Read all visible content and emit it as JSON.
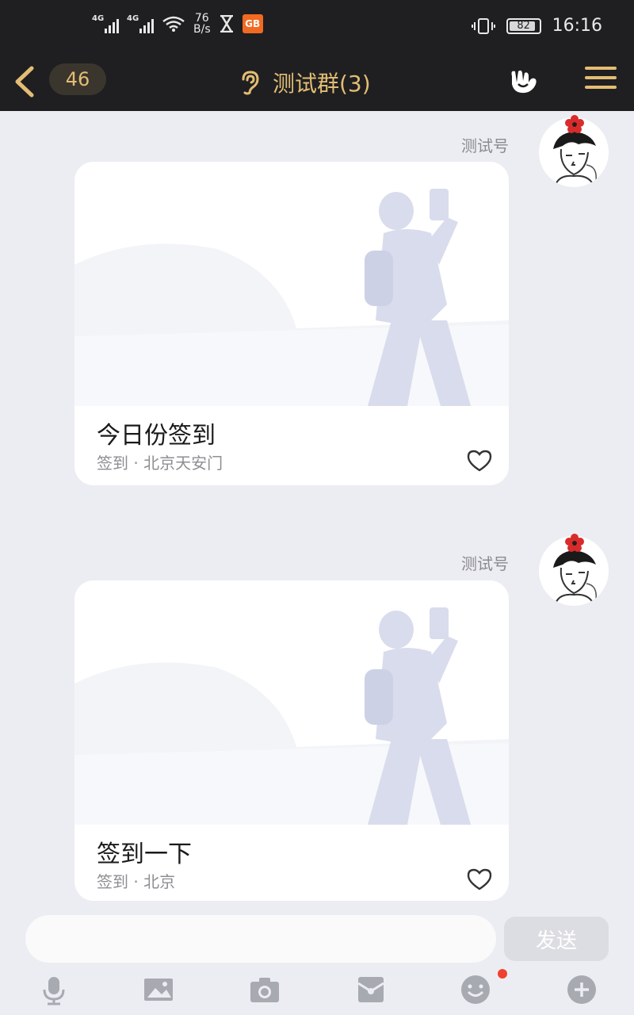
{
  "status_bar": {
    "network1": "4G",
    "network2": "4G",
    "speed_value": "76",
    "speed_unit": "B/s",
    "app_badge": "GB",
    "battery": "82",
    "time": "16:16"
  },
  "header": {
    "unread_count": "46",
    "title": "测试群(3)"
  },
  "messages": [
    {
      "sender": "测试号",
      "card_title": "今日份签到",
      "card_subtitle": "签到 · 北京天安门"
    },
    {
      "sender": "测试号",
      "card_title": "签到一下",
      "card_subtitle": "签到 · 北京"
    }
  ],
  "composer": {
    "input_value": "",
    "send_label": "发送"
  },
  "toolbar": {
    "icons": [
      "microphone-icon",
      "image-icon",
      "camera-icon",
      "red-packet-icon",
      "emoji-icon",
      "plus-icon"
    ]
  },
  "colors": {
    "header_bg": "#1f1f21",
    "accent_gold": "#e3bd74",
    "chat_bg": "#ecedf2",
    "notification_dot": "#f0402f"
  }
}
